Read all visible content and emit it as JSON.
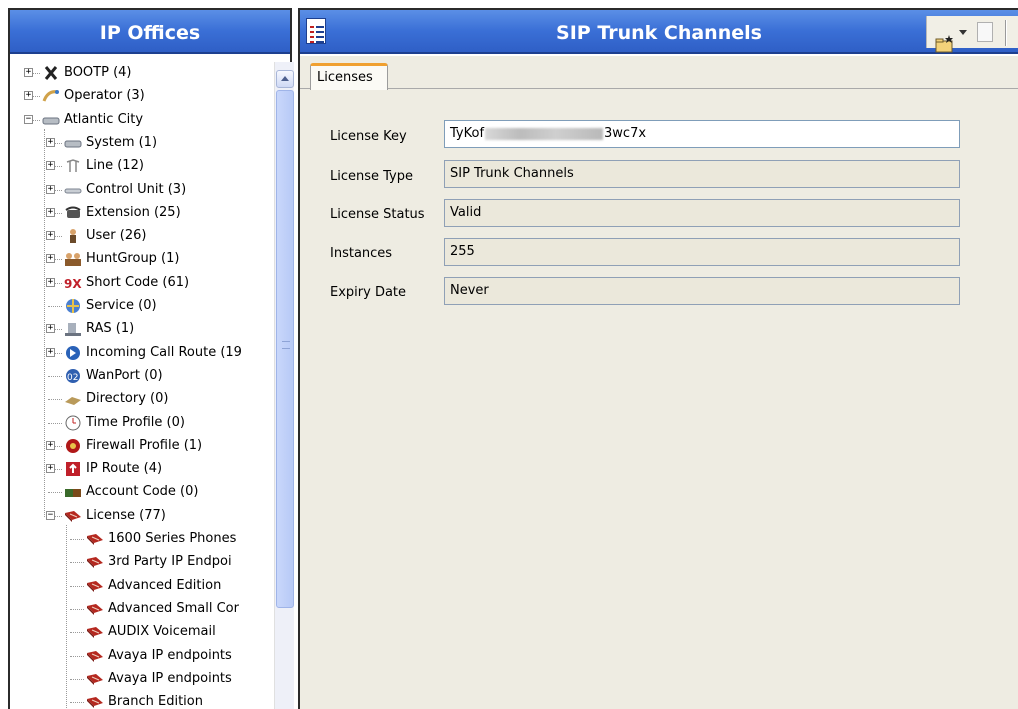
{
  "left_panel": {
    "title": "IP Offices",
    "tree": [
      {
        "label": "BOOTP (4)",
        "icon": "bootp-icon",
        "expandable": true,
        "expanded": false
      },
      {
        "label": "Operator (3)",
        "icon": "operator-icon",
        "expandable": true,
        "expanded": false
      },
      {
        "label": "Atlantic City",
        "icon": "system-icon",
        "expandable": true,
        "expanded": true
      },
      {
        "label": "System (1)",
        "icon": "system-icon",
        "expandable": true,
        "expanded": false
      },
      {
        "label": "Line (12)",
        "icon": "line-icon",
        "expandable": true,
        "expanded": false
      },
      {
        "label": "Control Unit (3)",
        "icon": "control-unit-icon",
        "expandable": true,
        "expanded": false
      },
      {
        "label": "Extension (25)",
        "icon": "extension-icon",
        "expandable": true,
        "expanded": false
      },
      {
        "label": "User (26)",
        "icon": "user-icon",
        "expandable": true,
        "expanded": false
      },
      {
        "label": "HuntGroup (1)",
        "icon": "huntgroup-icon",
        "expandable": true,
        "expanded": false
      },
      {
        "label": "Short Code (61)",
        "icon": "short-code-icon",
        "expandable": true,
        "expanded": false
      },
      {
        "label": "Service (0)",
        "icon": "service-icon",
        "expandable": false,
        "expanded": false
      },
      {
        "label": "RAS (1)",
        "icon": "ras-icon",
        "expandable": true,
        "expanded": false
      },
      {
        "label": "Incoming Call Route (19",
        "icon": "incoming-call-route-icon",
        "expandable": true,
        "expanded": false
      },
      {
        "label": "WanPort (0)",
        "icon": "wanport-icon",
        "expandable": false,
        "expanded": false
      },
      {
        "label": "Directory (0)",
        "icon": "directory-icon",
        "expandable": false,
        "expanded": false
      },
      {
        "label": "Time Profile (0)",
        "icon": "time-profile-icon",
        "expandable": false,
        "expanded": false
      },
      {
        "label": "Firewall Profile (1)",
        "icon": "firewall-icon",
        "expandable": true,
        "expanded": false
      },
      {
        "label": "IP Route (4)",
        "icon": "ip-route-icon",
        "expandable": true,
        "expanded": false
      },
      {
        "label": "Account Code (0)",
        "icon": "account-code-icon",
        "expandable": false,
        "expanded": false
      },
      {
        "label": "License (77)",
        "icon": "license-icon",
        "expandable": true,
        "expanded": true
      },
      {
        "label": "1600 Series Phones",
        "icon": "license-icon",
        "expandable": false,
        "expanded": false
      },
      {
        "label": "3rd Party IP Endpoi",
        "icon": "license-icon",
        "expandable": false,
        "expanded": false
      },
      {
        "label": "Advanced Edition",
        "icon": "license-icon",
        "expandable": false,
        "expanded": false
      },
      {
        "label": "Advanced Small Cor",
        "icon": "license-icon",
        "expandable": false,
        "expanded": false
      },
      {
        "label": "AUDIX Voicemail",
        "icon": "license-icon",
        "expandable": false,
        "expanded": false
      },
      {
        "label": "Avaya IP endpoints",
        "icon": "license-icon",
        "expandable": false,
        "expanded": false
      },
      {
        "label": "Avaya IP endpoints",
        "icon": "license-icon",
        "expandable": false,
        "expanded": false
      },
      {
        "label": "Branch Edition",
        "icon": "license-icon",
        "expandable": false,
        "expanded": false
      }
    ]
  },
  "right_panel": {
    "title": "SIP Trunk Channels",
    "tabs": [
      {
        "label": "Licenses",
        "active": true
      }
    ],
    "form": {
      "license_key": {
        "label": "License Key",
        "value_start": "TyKof",
        "value_end": "3wc7x"
      },
      "license_type": {
        "label": "License Type",
        "value": "SIP Trunk Channels"
      },
      "license_status": {
        "label": "License Status",
        "value": "Valid"
      },
      "instances": {
        "label": "Instances",
        "value": "255"
      },
      "expiry_date": {
        "label": "Expiry Date",
        "value": "Never"
      }
    }
  },
  "colors": {
    "title_bar": "#3a6fd6",
    "form_background": "#eeece2",
    "tab_accent": "#f0a030",
    "license_icon": "#b5281f"
  }
}
